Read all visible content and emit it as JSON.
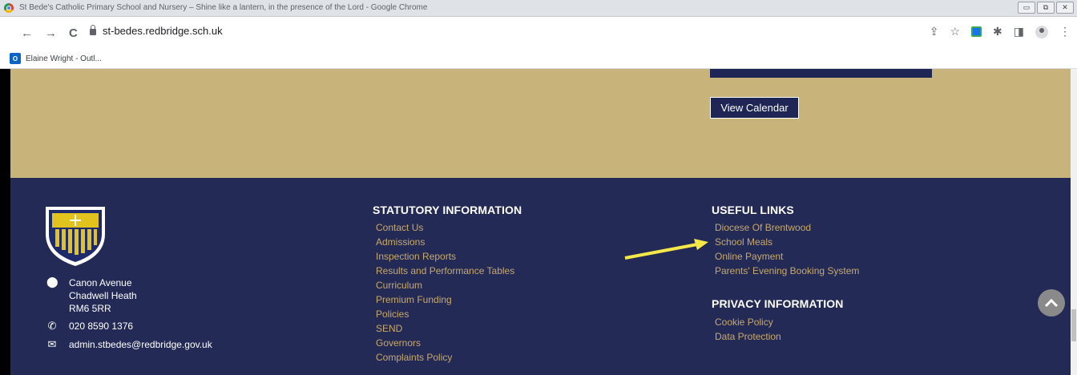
{
  "window": {
    "title": "St Bede's Catholic Primary School and Nursery – Shine like a lantern, in the presence of the Lord - Google Chrome",
    "controls": [
      "▭",
      "⧉",
      "✕"
    ]
  },
  "toolbar": {
    "url": "st-bedes.redbridge.sch.uk",
    "back_icon": "←",
    "forward_icon": "→",
    "reload_icon": "C"
  },
  "bookmarks": [
    {
      "label": "Elaine Wright - Outl...",
      "icon": "O"
    }
  ],
  "page": {
    "view_calendar_label": "View Calendar",
    "address": [
      "Canon Avenue",
      "Chadwell Heath",
      "RM6 5RR"
    ],
    "phone": "020 8590 1376",
    "email": "admin.stbedes@redbridge.gov.uk",
    "statutory": {
      "heading": "STATUTORY INFORMATION",
      "links": [
        "Contact Us",
        "Admissions",
        "Inspection Reports",
        "Results and Performance Tables",
        "Curriculum",
        "Premium Funding",
        "Policies",
        "SEND",
        "Governors",
        "Complaints Policy"
      ]
    },
    "useful": {
      "heading": "USEFUL LINKS",
      "links": [
        "Diocese Of Brentwood",
        "School Meals",
        "Online Payment",
        "Parents' Evening Booking System"
      ]
    },
    "privacy": {
      "heading": "PRIVACY INFORMATION",
      "links": [
        "Cookie Policy",
        "Data Protection"
      ]
    }
  },
  "colors": {
    "gold": "#c8b37a",
    "navy": "#232a55",
    "link": "#c8a86a",
    "arrow": "#f5e94a"
  }
}
